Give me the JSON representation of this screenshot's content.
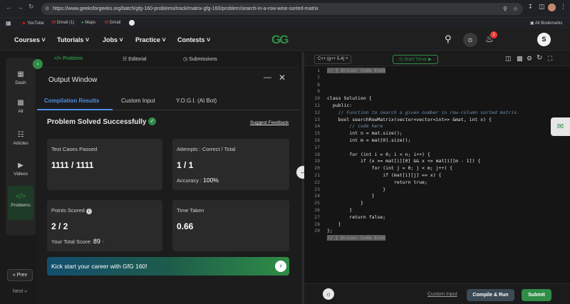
{
  "browser": {
    "url": "https://www.geeksforgeeks.org/batch/gfg-160-problems/track/matrix-gfg-160/problem/search-in-a-row-wise-sorted-matrix",
    "bookmarks": [
      "YouTube",
      "Gmail (1)",
      "Maps",
      "Gmail"
    ],
    "all_bookmarks": "All Bookmarks",
    "profile_initial": "S"
  },
  "nav": {
    "items": [
      "Courses",
      "Tutorials",
      "Jobs",
      "Practice",
      "Contests"
    ],
    "logo": "GG",
    "notification_count": "1",
    "avatar": "S"
  },
  "rail": {
    "items": [
      "Dash",
      "All",
      "Articles",
      "Videos",
      "Problems"
    ],
    "prev": "Prev",
    "next": "Next"
  },
  "tabs": {
    "problem": "Problem",
    "editorial": "Editorial",
    "submissions": "Submissions"
  },
  "output": {
    "title": "Output Window",
    "tabs": [
      "Compilation Results",
      "Custom Input",
      "Y.O.G.I. (AI Bot)"
    ],
    "status": "Problem Solved Successfully",
    "suggest_feedback": "Suggest Feedback",
    "test_cases_label": "Test Cases Passed",
    "test_cases_value": "1111 / 1111",
    "attempts_label": "Attempts : Correct / Total",
    "attempts_value": "1 / 1",
    "accuracy_label": "Accuracy :",
    "accuracy_value": "100%",
    "points_label": "Points Scored",
    "points_value": "2 / 2",
    "total_score_label": "Your Total Score:",
    "total_score_value": "89",
    "time_label": "Time Taken",
    "time_value": "0.66",
    "banner": "Kick start your career with GfG 160!"
  },
  "editor": {
    "language": "C++ (g++ 5.4)",
    "start_timer": "Start Timer",
    "lines": [
      {
        "n": "1",
        "t": "// } Driver Code Ends"
      },
      {
        "n": "7",
        "t": ""
      },
      {
        "n": "8",
        "t": ""
      },
      {
        "n": "9",
        "t": ""
      },
      {
        "n": "10",
        "t": "class Solution {"
      },
      {
        "n": "11",
        "t": "  public:"
      },
      {
        "n": "12",
        "t": "    // Function to search a given number in row-column sorted matrix."
      },
      {
        "n": "13",
        "t": "    bool searchRowMatrix(vector<vector<int>> &mat, int x) {"
      },
      {
        "n": "14",
        "t": "        // code here"
      },
      {
        "n": "15",
        "t": "        int n = mat.size();"
      },
      {
        "n": "16",
        "t": "        int m = mat[0].size();"
      },
      {
        "n": "17",
        "t": ""
      },
      {
        "n": "18",
        "t": "        for (int i = 0; i < n; i++) {"
      },
      {
        "n": "19",
        "t": "            if (x >= mat[i][0] && x <= mat[i][m - 1]) {"
      },
      {
        "n": "20",
        "t": "                for (int j = 0; j < m; j++) {"
      },
      {
        "n": "21",
        "t": "                    if (mat[i][j] == x) {"
      },
      {
        "n": "22",
        "t": "                        return true;"
      },
      {
        "n": "23",
        "t": "                    }"
      },
      {
        "n": "24",
        "t": "                }"
      },
      {
        "n": "25",
        "t": "            }"
      },
      {
        "n": "26",
        "t": "        }"
      },
      {
        "n": "27",
        "t": "        return false;"
      },
      {
        "n": "28",
        "t": "    }"
      },
      {
        "n": "29",
        "t": "};"
      },
      {
        "n": "",
        "t": "// } Driver Code Ends"
      }
    ],
    "custom_input": "Custom Input",
    "compile_run": "Compile & Run",
    "submit": "Submit"
  },
  "colors": {
    "accent_green": "#2f8d46",
    "success_green": "#34a853",
    "submit_green": "#2f8d46",
    "badge_red": "#e53935"
  }
}
